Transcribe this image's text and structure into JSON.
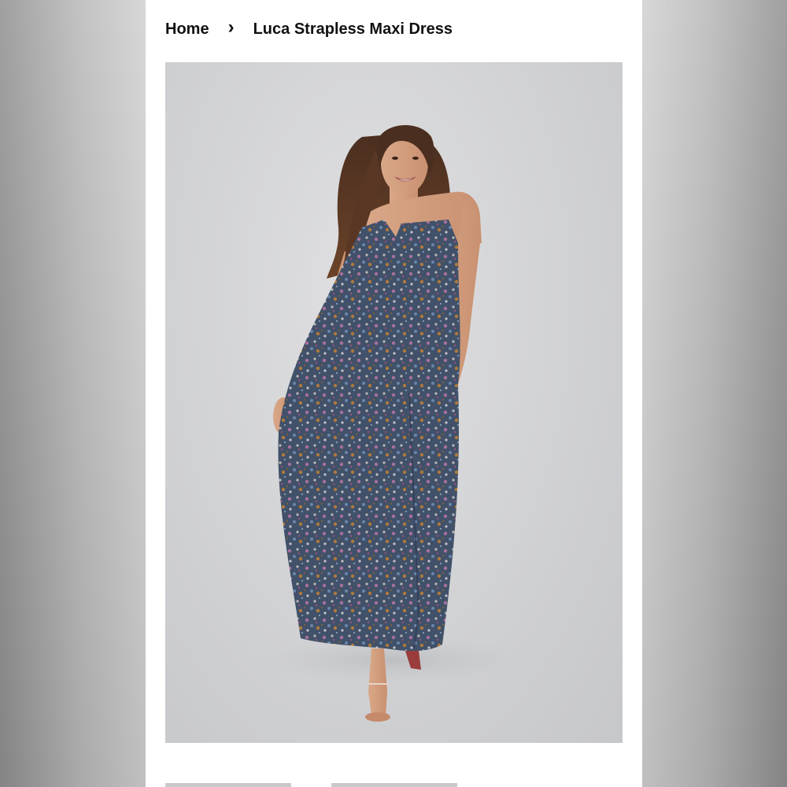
{
  "breadcrumb": {
    "home_label": "Home",
    "separator": "›",
    "current_label": "Luca Strapless Maxi Dress"
  },
  "product": {
    "image_icon": "product-photo",
    "thumbnail_count": 2
  },
  "colors": {
    "page_background": "#ffffff",
    "photo_background": "#d2d3d5",
    "text": "#111111"
  }
}
